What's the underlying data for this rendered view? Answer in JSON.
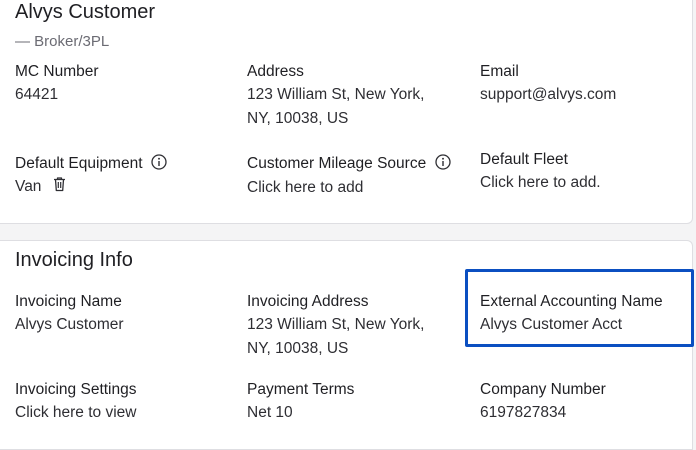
{
  "customer": {
    "name": "Alvys Customer",
    "type": "— Broker/3PL",
    "mc_number": {
      "label": "MC Number",
      "value": "64421"
    },
    "address": {
      "label": "Address",
      "line1": "123 William St, New York,",
      "line2": "NY, 10038, US"
    },
    "email": {
      "label": "Email",
      "value": "support@alvys.com"
    },
    "default_equipment": {
      "label": "Default Equipment",
      "value": "Van"
    },
    "mileage_source": {
      "label": "Customer Mileage Source",
      "value": "Click here to add"
    },
    "default_fleet": {
      "label": "Default Fleet",
      "value": "Click here to add."
    }
  },
  "invoicing": {
    "title": "Invoicing Info",
    "name": {
      "label": "Invoicing Name",
      "value": "Alvys Customer"
    },
    "address": {
      "label": "Invoicing Address",
      "line1": "123 William St, New York,",
      "line2": "NY, 10038, US"
    },
    "external_name": {
      "label": "External Accounting Name",
      "value": "Alvys Customer Acct"
    },
    "settings": {
      "label": "Invoicing Settings",
      "value": "Click here to view"
    },
    "payment_terms": {
      "label": "Payment Terms",
      "value": "Net 10"
    },
    "company_number": {
      "label": "Company Number",
      "value": "6197827834"
    }
  },
  "colors": {
    "highlight": "#0b4fc1",
    "text": "#1f1f23",
    "muted": "#6b6b73"
  }
}
